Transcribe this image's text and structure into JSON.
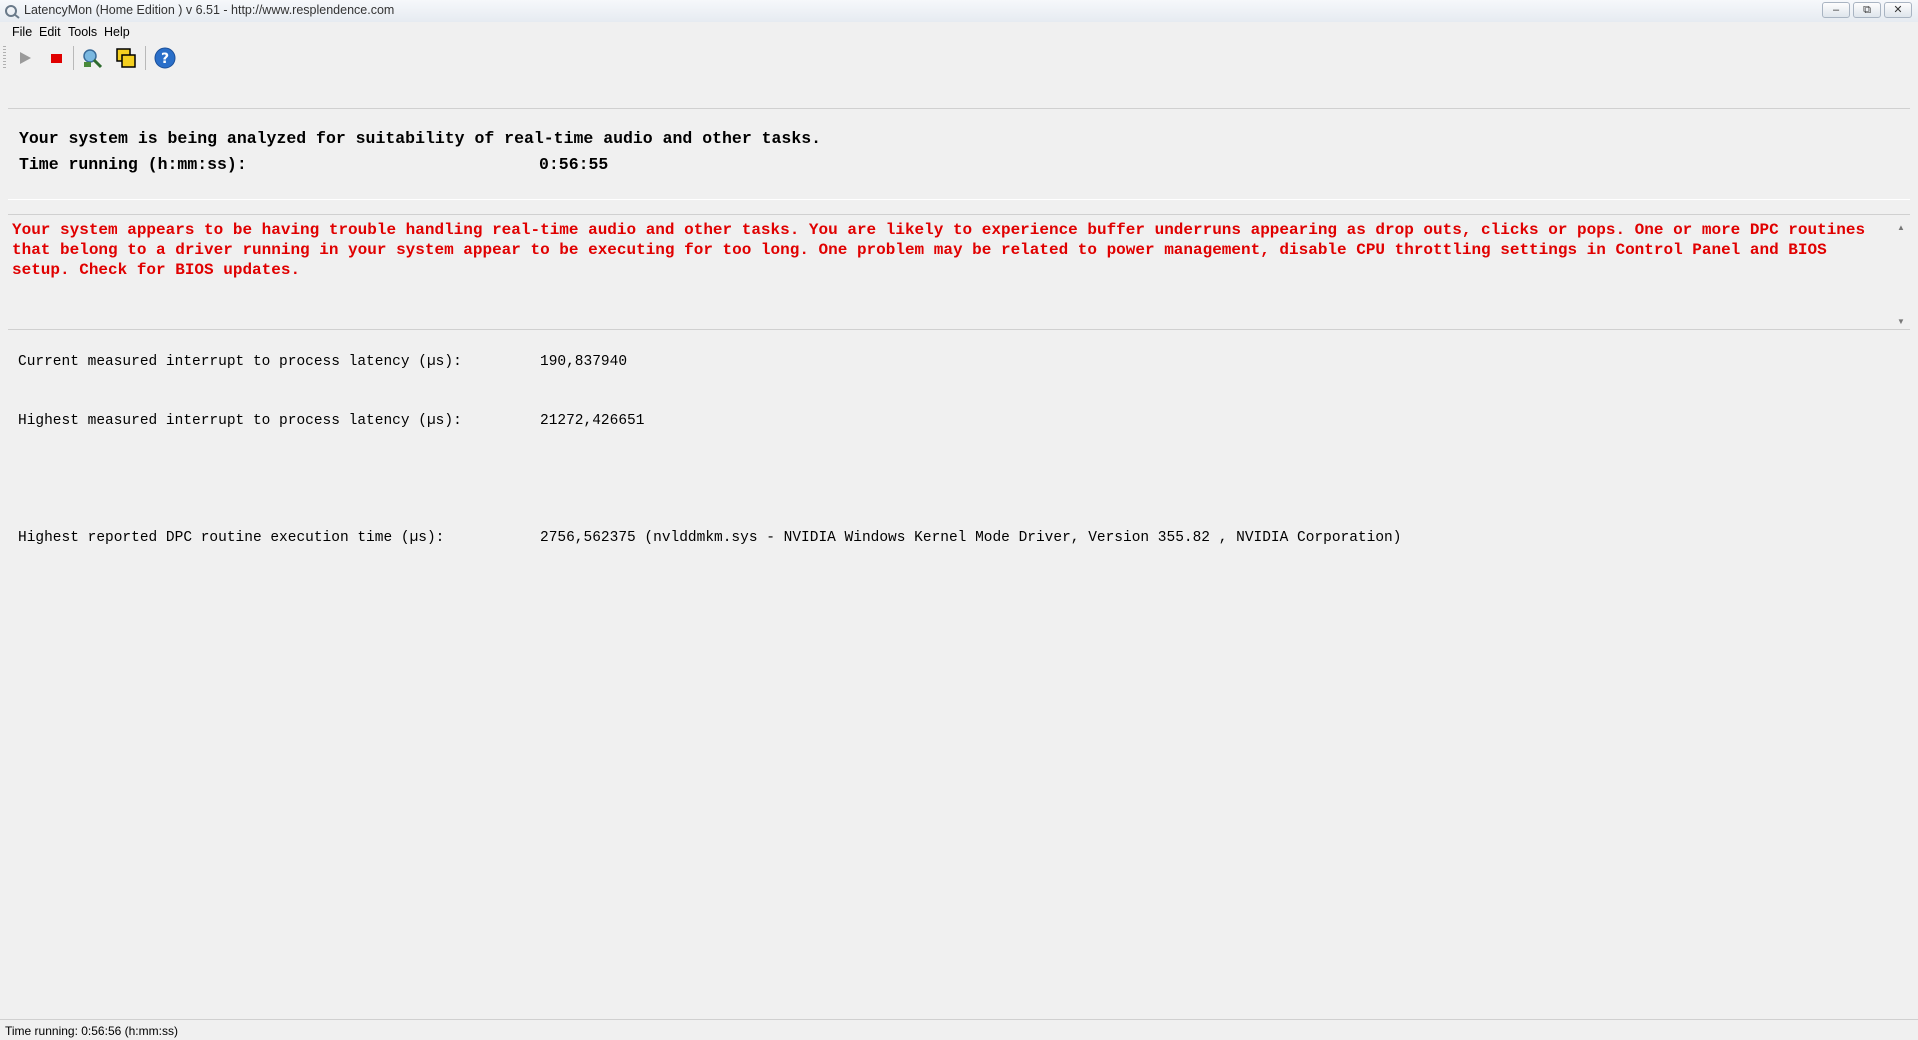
{
  "window": {
    "title": "LatencyMon  (Home Edition )  v 6.51 - http://www.resplendence.com",
    "minimize_glyph": "–",
    "maximize_glyph": "⧉",
    "close_glyph": "✕"
  },
  "menu": {
    "file": "File",
    "edit": "Edit",
    "tools": "Tools",
    "help": "Help"
  },
  "toolbar": {
    "icons": [
      "play-icon",
      "stop-icon",
      "drivers-icon",
      "windows-icon",
      "help-icon"
    ],
    "colors": {
      "stop": "#e00000",
      "help": "#2a6fc9",
      "play": "#9a9a9a"
    }
  },
  "status": {
    "headline": "Your system is being analyzed for suitability of real-time audio and other tasks.",
    "time_label": "Time running (h:mm:ss):",
    "time_value": "0:56:55"
  },
  "warning": {
    "text": "Your system appears to be having trouble handling real-time audio and other tasks. You are likely to experience buffer underruns appearing as drop outs, clicks or pops. One or more DPC routines that belong to a driver running in your system appear to be executing for too long. One problem may be related to power management, disable CPU throttling settings in Control Panel and BIOS setup. Check for BIOS updates.",
    "color": "#e00000"
  },
  "metrics": [
    {
      "label": "Current measured interrupt to process latency (µs):",
      "value": "190,837940"
    },
    {
      "label": "Highest measured interrupt to process latency (µs):",
      "value": "21272,426651"
    },
    {
      "label": "Highest reported DPC routine execution time (µs):",
      "value": "2756,562375  (nvlddmkm.sys - NVIDIA Windows Kernel Mode Driver, Version 355.82 , NVIDIA Corporation)"
    }
  ],
  "statusbar": {
    "text": "Time running: 0:56:56  (h:mm:ss)"
  }
}
